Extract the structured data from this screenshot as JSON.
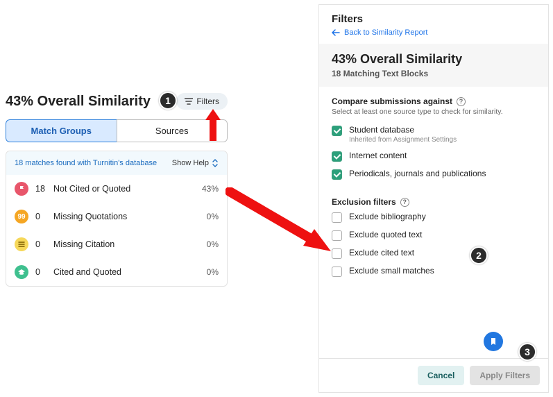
{
  "left": {
    "title": "43% Overall Similarity",
    "filters_btn": "Filters",
    "tabs": {
      "match_groups": "Match Groups",
      "sources": "Sources"
    },
    "db_msg": "18 matches found with Turnitin's database",
    "show_help": "Show Help",
    "rows": [
      {
        "count": "18",
        "label": "Not Cited or Quoted",
        "pct": "43%"
      },
      {
        "count": "0",
        "label": "Missing Quotations",
        "pct": "0%"
      },
      {
        "count": "0",
        "label": "Missing Citation",
        "pct": "0%"
      },
      {
        "count": "0",
        "label": "Cited and Quoted",
        "pct": "0%"
      }
    ]
  },
  "right": {
    "head_title": "Filters",
    "back_label": "Back to Similarity Report",
    "summary_big": "43% Overall Similarity",
    "summary_sub": "18 Matching Text Blocks",
    "compare": {
      "title": "Compare submissions against",
      "desc": "Select at least one source type to check for similarity.",
      "items": [
        {
          "label": "Student database",
          "sub": "Inherited from Assignment Settings",
          "checked": true
        },
        {
          "label": "Internet content",
          "sub": "",
          "checked": true
        },
        {
          "label": "Periodicals, journals and publications",
          "sub": "",
          "checked": true
        }
      ]
    },
    "exclusion": {
      "title": "Exclusion filters",
      "items": [
        {
          "label": "Exclude bibliography",
          "checked": false
        },
        {
          "label": "Exclude quoted text",
          "checked": false
        },
        {
          "label": "Exclude cited text",
          "checked": false
        },
        {
          "label": "Exclude small matches",
          "checked": false
        }
      ]
    },
    "buttons": {
      "cancel": "Cancel",
      "apply": "Apply Filters"
    }
  },
  "annotations": {
    "b1": "1",
    "b2": "2",
    "b3": "3"
  }
}
